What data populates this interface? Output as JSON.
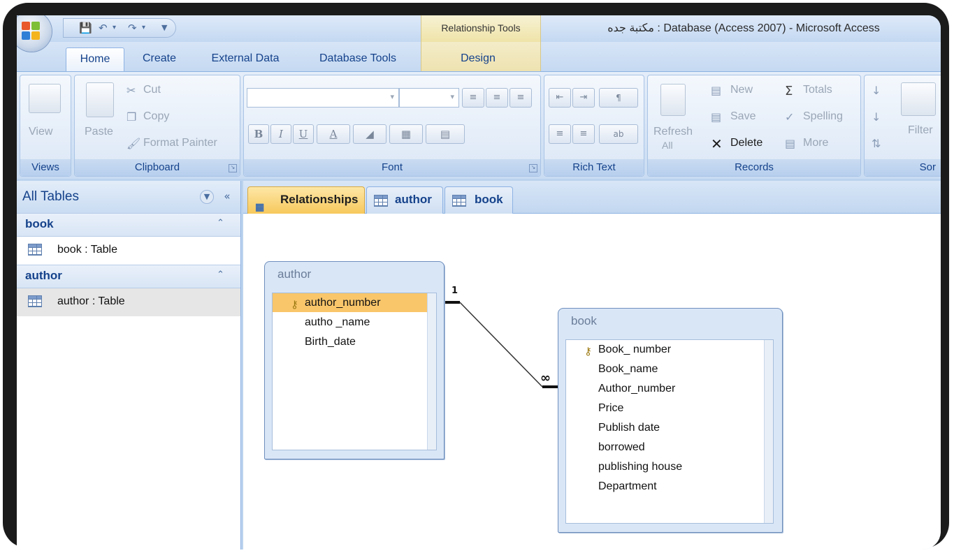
{
  "window": {
    "context_tab": "Relationship Tools",
    "title": "مكتبة جده : Database (Access 2007) - Microsoft Access"
  },
  "ribbon_tabs": [
    "Home",
    "Create",
    "External Data",
    "Database Tools",
    "Design"
  ],
  "groups": {
    "views": {
      "label": "Views",
      "view": "View"
    },
    "clipboard": {
      "label": "Clipboard",
      "paste": "Paste",
      "cut": "Cut",
      "copy": "Copy",
      "format_painter": "Format Painter"
    },
    "font": {
      "label": "Font",
      "bold": "B",
      "italic": "I",
      "underline": "U",
      "font_color": "A"
    },
    "rich_text": {
      "label": "Rich Text"
    },
    "records": {
      "label": "Records",
      "refresh": "Refresh",
      "refresh_sub": "All",
      "new": "New",
      "save": "Save",
      "delete": "Delete",
      "totals": "Totals",
      "spelling": "Spelling",
      "more": "More"
    },
    "sort_filter": {
      "label": "Sor",
      "filter": "Filter"
    }
  },
  "nav_pane": {
    "title": "All Tables",
    "groups": [
      {
        "name": "book",
        "items": [
          "book : Table"
        ]
      },
      {
        "name": "author",
        "items": [
          "author : Table"
        ]
      }
    ]
  },
  "document_tabs": [
    "Relationships",
    "author",
    "book"
  ],
  "relationship": {
    "one_label": "1",
    "many_label": "∞"
  },
  "tables": [
    {
      "name": "author",
      "fields": [
        "author_number",
        "autho _name",
        "Birth_date"
      ],
      "primary_key": "author_number"
    },
    {
      "name": "book",
      "fields": [
        "Book_ number",
        "Book_name",
        "Author_number",
        "Price",
        "Publish date",
        "borrowed",
        "publishing house",
        "Department"
      ],
      "primary_key": "Book_ number"
    }
  ],
  "colors": {
    "accent": "#15428b",
    "selected_field": "#f9c66a",
    "active_tab": "#f7c85c"
  },
  "icons": {
    "office_button": "office-logo",
    "save": "save-icon",
    "undo": "undo-icon",
    "redo": "redo-icon",
    "key": "key-icon",
    "table": "table-icon"
  }
}
